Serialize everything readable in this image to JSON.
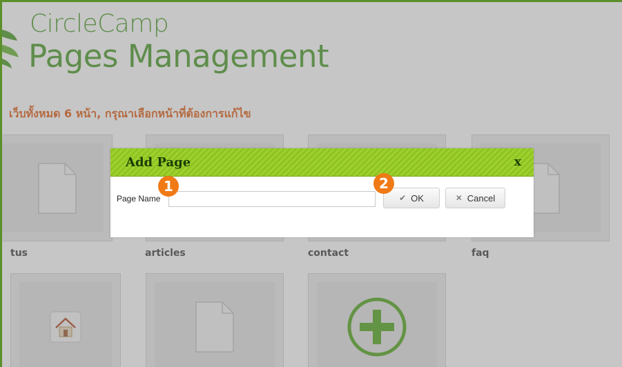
{
  "brand": {
    "line1": "CircleCamp",
    "line2": "Pages Management",
    "color": "#4f9e2d"
  },
  "headline": "เว็บทั้งหมด 6 หน้า, กรุณาเลือกหน้าที่ต้องการแก้ไข",
  "pages": [
    {
      "label": "tus",
      "icon": "document-icon"
    },
    {
      "label": "articles",
      "icon": "document-icon"
    },
    {
      "label": "contact",
      "icon": "document-icon"
    },
    {
      "label": "faq",
      "icon": "document-icon"
    },
    {
      "label": "",
      "icon": "home-icon"
    },
    {
      "label": "",
      "icon": "document-icon"
    }
  ],
  "add_tile": {
    "icon": "add-icon"
  },
  "dialog": {
    "title": "Add Page",
    "close_label": "x",
    "field_label": "Page Name",
    "field_value": "",
    "ok_label": "OK",
    "cancel_label": "Cancel",
    "header_color": "#9ed12e"
  },
  "markers": [
    "1",
    "2"
  ],
  "accent_color": "#f07a16"
}
